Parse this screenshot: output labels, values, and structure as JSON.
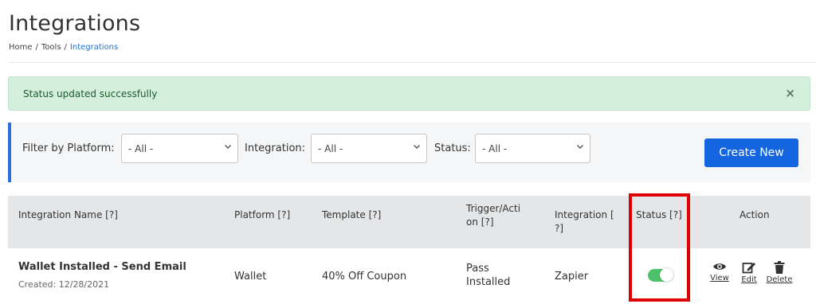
{
  "page": {
    "title": "Integrations",
    "breadcrumb": [
      "Home",
      "Tools",
      "Integrations"
    ]
  },
  "alert": {
    "message": "Status updated successfully",
    "close_glyph": "×"
  },
  "filters": {
    "platform_label": "Filter by Platform:",
    "platform_value": "- All -",
    "integration_label": "Integration:",
    "integration_value": "- All -",
    "status_label": "Status:",
    "status_value": "- All -",
    "create_button": "Create New"
  },
  "table": {
    "headers": {
      "name": "Integration Name [?]",
      "platform": "Platform [?]",
      "template": "Template [?]",
      "trigger_line1": "Trigger/Acti",
      "trigger_line2": "on [?]",
      "integration_line1": "Integration [",
      "integration_line2": "?]",
      "status": "Status [?]",
      "action": "Action"
    },
    "rows": [
      {
        "name": "Wallet Installed - Send Email",
        "created": "Created: 12/28/2021",
        "platform": "Wallet",
        "template": "40% Off Coupon",
        "trigger_line1": "Pass",
        "trigger_line2": "Installed",
        "integration": "Zapier",
        "status_enabled": true,
        "actions": {
          "view": "View",
          "edit": "Edit",
          "delete": "Delete"
        }
      }
    ]
  },
  "colors": {
    "accent": "#1565e0",
    "alert_bg": "#d4efdc",
    "toggle_on": "#4cc36b",
    "highlight": "#e00000"
  },
  "icons": {
    "view": "eye-icon",
    "edit": "edit-icon",
    "delete": "trash-icon",
    "select": "chevron-down-icon",
    "close": "close-icon"
  }
}
